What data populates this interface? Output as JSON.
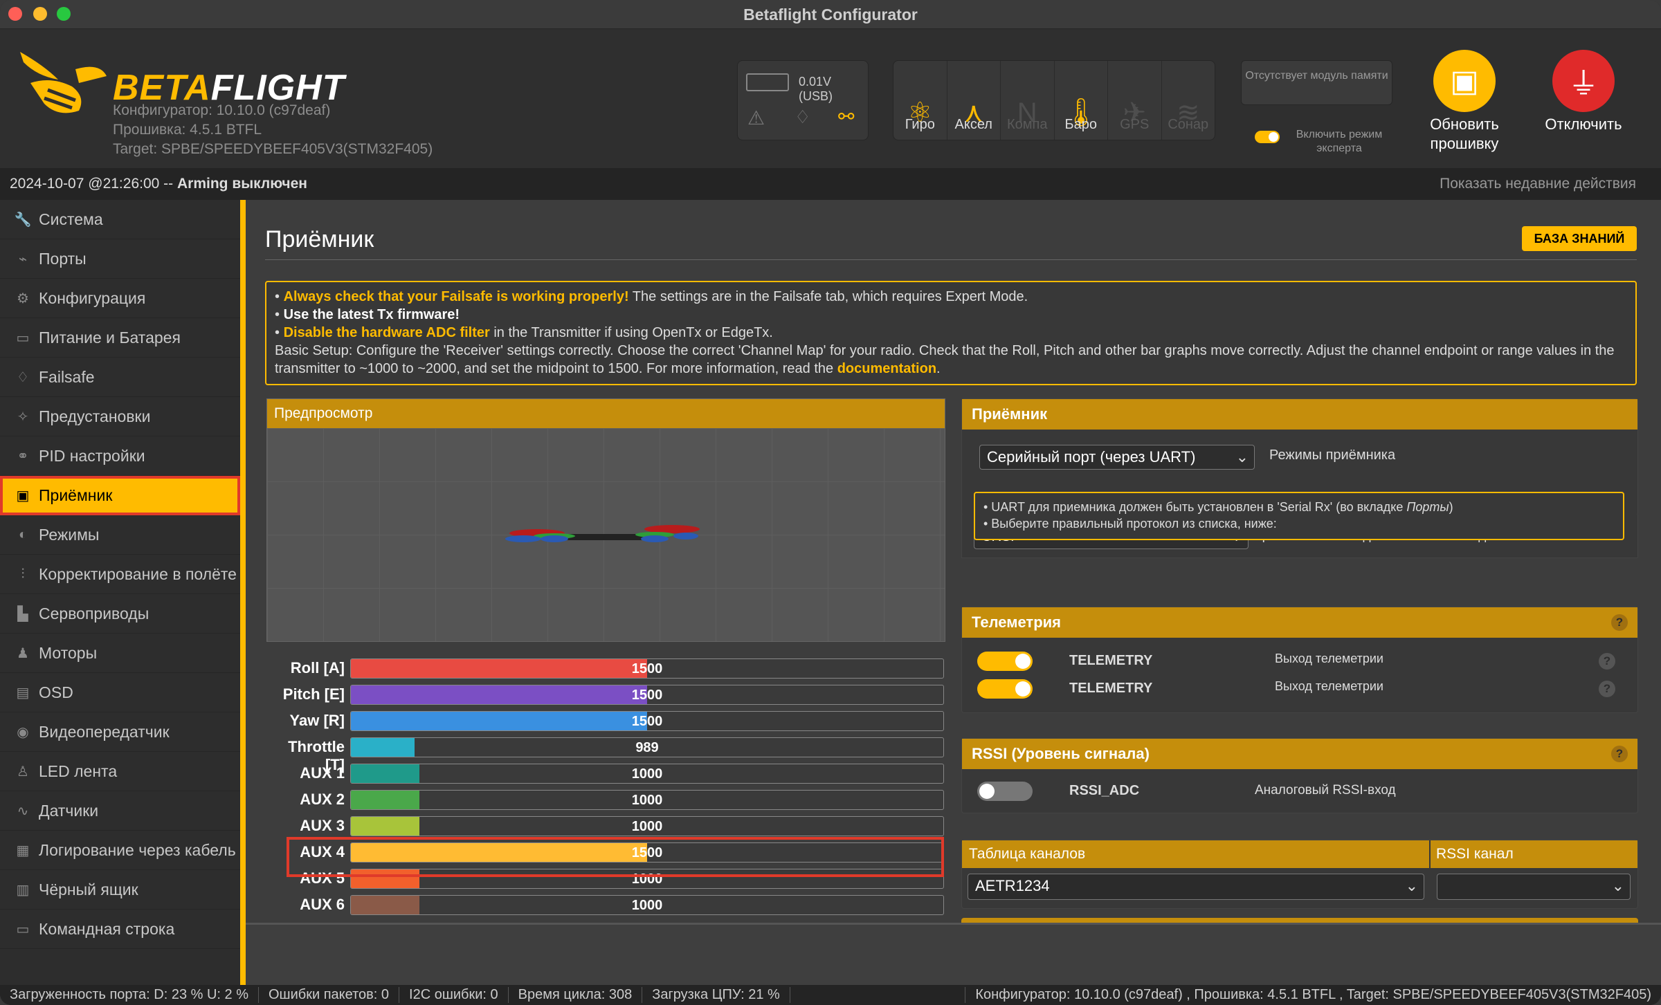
{
  "window": {
    "title": "Betaflight Configurator"
  },
  "header": {
    "logo_b": "BETA",
    "logo_f": "FLIGHT",
    "configurator": "Конфигуратор: 10.10.0 (c97deaf)",
    "firmware": "Прошивка: 4.5.1 BTFL",
    "target": "Target: SPBE/SPEEDYBEEF405V3(STM32F405)",
    "battery": "0.01V (USB)",
    "sensors": [
      {
        "label": "Гиро",
        "icon": "gyro-icon",
        "active": true
      },
      {
        "label": "Аксел",
        "icon": "accel-icon",
        "active": true
      },
      {
        "label": "Компа",
        "icon": "compass-icon",
        "active": false
      },
      {
        "label": "Баро",
        "icon": "baro-icon",
        "active": true
      },
      {
        "label": "GPS",
        "icon": "gps-icon",
        "active": false
      },
      {
        "label": "Сонар",
        "icon": "sonar-icon",
        "active": false
      }
    ],
    "no_memory": "Отсутствует модуль памяти",
    "expert_mode": "Включить режим эксперта",
    "update_fw": "Обновить прошивку",
    "disconnect": "Отключить"
  },
  "status": {
    "datetime": "2024-10-07 @21:26:00 -- ",
    "arming": "Arming выключен",
    "recent": "Показать недавние действия"
  },
  "sidebar": {
    "items": [
      {
        "label": "Система",
        "icon": "wrench-icon"
      },
      {
        "label": "Порты",
        "icon": "plug-icon"
      },
      {
        "label": "Конфигурация",
        "icon": "gear-icon"
      },
      {
        "label": "Питание и Батарея",
        "icon": "battery-icon"
      },
      {
        "label": "Failsafe",
        "icon": "parachute-icon"
      },
      {
        "label": "Предустановки",
        "icon": "wand-icon"
      },
      {
        "label": "PID настройки",
        "icon": "pid-icon"
      },
      {
        "label": "Приёмник",
        "icon": "receiver-icon"
      },
      {
        "label": "Режимы",
        "icon": "toggle-icon"
      },
      {
        "label": "Корректирование в полёте",
        "icon": "sliders-icon"
      },
      {
        "label": "Сервоприводы",
        "icon": "servo-icon"
      },
      {
        "label": "Моторы",
        "icon": "motor-icon"
      },
      {
        "label": "OSD",
        "icon": "osd-icon"
      },
      {
        "label": "Видеопередатчик",
        "icon": "antenna-icon"
      },
      {
        "label": "LED лента",
        "icon": "led-icon"
      },
      {
        "label": "Датчики",
        "icon": "sensors-icon"
      },
      {
        "label": "Логирование через кабель",
        "icon": "log-icon"
      },
      {
        "label": "Чёрный ящик",
        "icon": "blackbox-icon"
      },
      {
        "label": "Командная строка",
        "icon": "terminal-icon"
      }
    ],
    "active_index": 7
  },
  "main": {
    "title": "Приёмник",
    "kb_button": "БАЗА ЗНАНИЙ",
    "note": {
      "l1_hl": "Always check that your Failsafe is working properly!",
      "l1_rest": " The settings are in the Failsafe tab, which requires Expert Mode.",
      "l2": "Use the latest Tx firmware!",
      "l3_hl": "Disable the hardware ADC filter",
      "l3_rest": " in the Transmitter if using OpenTx or EdgeTx.",
      "l4": "Basic Setup: Configure the 'Receiver' settings correctly. Choose the correct 'Channel Map' for your radio. Check that the Roll, Pitch and other bar graphs move correctly. Adjust the channel endpoint or range values in the transmitter to ~1000 to ~2000, and set the midpoint to 1500. For more information, read the ",
      "l4_link": "documentation",
      "l4_end": "."
    },
    "preview_title": "Предпросмотр",
    "channels": [
      {
        "name": "Roll [A]",
        "value": 1500,
        "color": "#e84b42"
      },
      {
        "name": "Pitch [E]",
        "value": 1500,
        "color": "#7b4fc4"
      },
      {
        "name": "Yaw [R]",
        "value": 1500,
        "color": "#3a90e0"
      },
      {
        "name": "Throttle [T]",
        "value": 989,
        "color": "#2ab0c8"
      },
      {
        "name": "AUX 1",
        "value": 1000,
        "color": "#1f9a8a"
      },
      {
        "name": "AUX 2",
        "value": 1000,
        "color": "#4aa84a"
      },
      {
        "name": "AUX 3",
        "value": 1000,
        "color": "#a8c43a"
      },
      {
        "name": "AUX 4",
        "value": 1500,
        "color": "#ffbb33"
      },
      {
        "name": "AUX 5",
        "value": 1000,
        "color": "#f2602c"
      },
      {
        "name": "AUX 6",
        "value": 1000,
        "color": "#8a5a48"
      }
    ],
    "receiver": {
      "title": "Приёмник",
      "mode": "Серийный порт (через UART)",
      "mode_label": "Режимы приёмника",
      "info1_a": "• UART для приемника должен быть установлен в 'Serial Rx' (во вкладке ",
      "info1_i": "Порты",
      "info1_b": ")",
      "info2": "• Выберите правильный протокол из списка, ниже:",
      "protocol": "CRSF",
      "protocol_label": "Приемник с последовательным выходом"
    },
    "telemetry": {
      "title": "Телеметрия",
      "rows": [
        {
          "name": "TELEMETRY",
          "desc": "Выход телеметрии"
        },
        {
          "name": "TELEMETRY",
          "desc": "Выход телеметрии"
        }
      ]
    },
    "rssi": {
      "title": "RSSI (Уровень сигнала)",
      "name": "RSSI_ADC",
      "desc": "Аналоговый RSSI-вход"
    },
    "channel_map": {
      "title": "Таблица каналов",
      "value": "AETR1234",
      "rssi_title": "RSSI канал",
      "rssi_value": ""
    }
  },
  "footer": {
    "port": "Загруженность порта: D: 23 % U: 2 %",
    "packets": "Ошибки пакетов: 0",
    "i2c": "I2C ошибки: 0",
    "cycle": "Время цикла: 308",
    "cpu": "Загрузка ЦПУ: 21 %",
    "version": "Конфигуратор: 10.10.0 (c97deaf) , Прошивка: 4.5.1 BTFL , Target: SPBE/SPEEDYBEEF405V3(STM32F405)"
  }
}
